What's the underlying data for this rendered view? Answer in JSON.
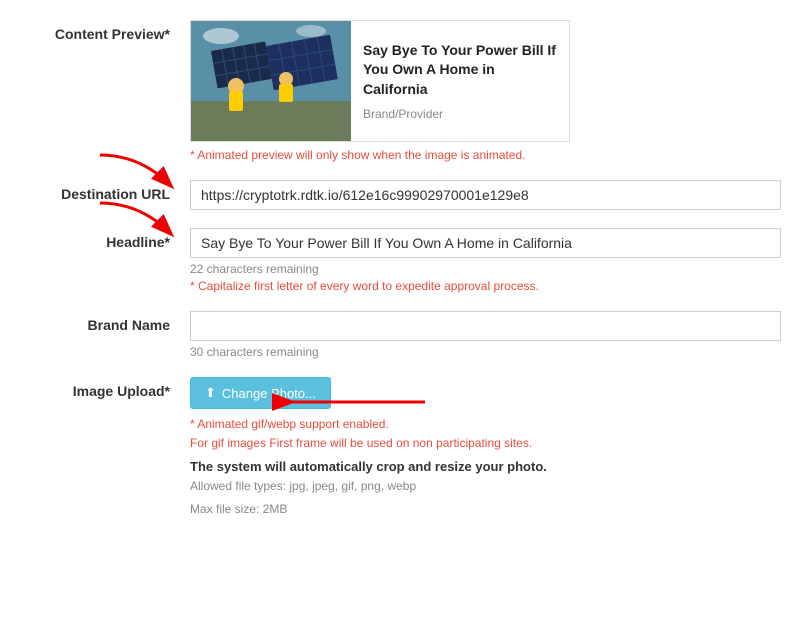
{
  "form": {
    "content_preview": {
      "label": "Content Preview*",
      "title": "Say Bye To Your Power Bill If You Own A Home in California",
      "brand": "Brand/Provider",
      "animated_note": "* Animated preview will only show when the image is animated."
    },
    "destination_url": {
      "label": "Destination URL",
      "value": "https://cryptotrk.rdtk.io/612e16c99902970001e129e8"
    },
    "headline": {
      "label": "Headline*",
      "value": "Say Bye To Your Power Bill If You Own A Home in California",
      "char_remaining": "22 characters remaining",
      "capitalize_note": "* Capitalize first letter of every word to expedite approval process."
    },
    "brand_name": {
      "label": "Brand Name",
      "value": "",
      "char_remaining": "30 characters remaining"
    },
    "image_upload": {
      "label": "Image Upload*",
      "button_label": "Change Photo...",
      "animated_note1": "* Animated gif/webp support enabled.",
      "animated_note2": "For gif images First frame will be used on non participating sites.",
      "crop_note": "The system will automatically crop and resize your photo.",
      "allowed_types": "Allowed file types: jpg, jpeg, gif, png, webp",
      "max_size": "Max file size: 2MB"
    }
  },
  "icons": {
    "upload": "⬆"
  }
}
